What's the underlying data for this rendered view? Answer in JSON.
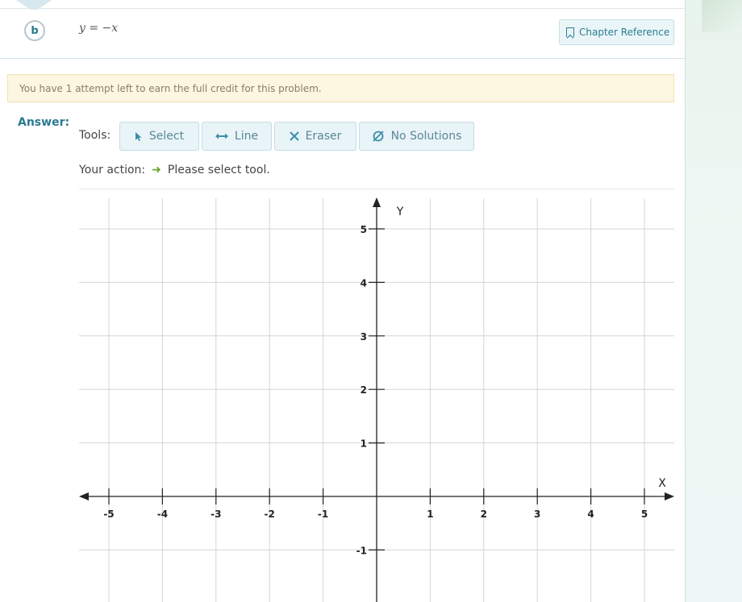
{
  "problem": {
    "part_label": "b",
    "equation": "y = −x"
  },
  "chapter_reference": {
    "label": "Chapter Reference"
  },
  "notice": {
    "text": "You have 1 attempt left to earn the full credit for this problem."
  },
  "answer": {
    "label": "Answer:",
    "tools_label": "Tools:",
    "tools": [
      {
        "label": "Select",
        "icon": "cursor-icon"
      },
      {
        "label": "Line",
        "icon": "double-arrow-icon"
      },
      {
        "label": "Eraser",
        "icon": "x-icon"
      },
      {
        "label": "No Solutions",
        "icon": "empty-set-icon"
      }
    ],
    "action_label": "Your action:",
    "action_text": "Please select tool."
  },
  "graph": {
    "x_axis_label": "X",
    "y_axis_label": "Y",
    "x_ticks": [
      "-5",
      "-4",
      "-3",
      "-2",
      "-1",
      "1",
      "2",
      "3",
      "4",
      "5"
    ],
    "y_ticks_positive": [
      "5",
      "4",
      "3",
      "2",
      "1"
    ],
    "y_ticks_negative": [
      "-1"
    ],
    "x_range": [
      -5.5,
      5.5
    ],
    "y_range_visible": [
      -1.9,
      5.5
    ],
    "grid": true
  }
}
